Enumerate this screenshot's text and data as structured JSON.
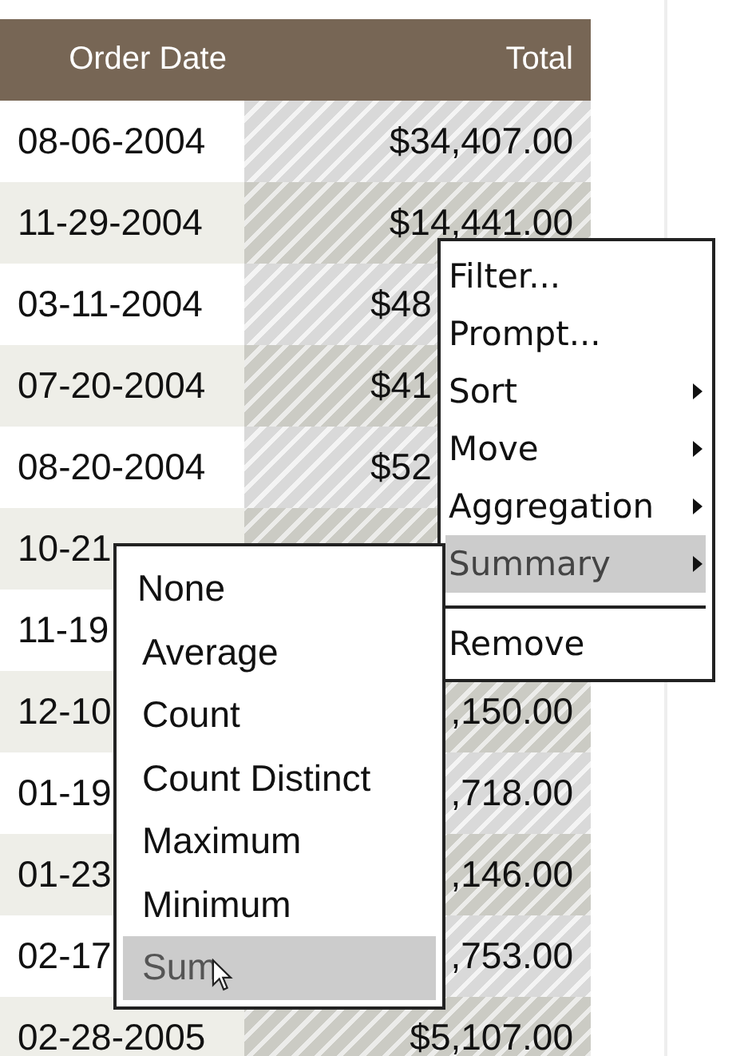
{
  "table": {
    "columns": [
      {
        "label": "Order Date"
      },
      {
        "label": "Total"
      }
    ],
    "rows": [
      {
        "date": "08-06-2004",
        "total": "$34,407.00",
        "total_cut_at_end": false
      },
      {
        "date": "11-29-2004",
        "total": "$14,441.00",
        "total_cut_at_end": false
      },
      {
        "date": "03-11-2004",
        "total": "$48",
        "total_cut_at_end": true
      },
      {
        "date": "07-20-2004",
        "total": "$41",
        "total_cut_at_end": true
      },
      {
        "date": "08-20-2004",
        "total": "$52",
        "total_cut_at_end": true
      },
      {
        "date": "10-21"
      },
      {
        "date": "11-19"
      },
      {
        "date": "12-10",
        "total": ",150.00",
        "total_cut_at_end": false
      },
      {
        "date": "01-19",
        "total": ",718.00",
        "total_cut_at_end": false
      },
      {
        "date": "01-23",
        "total": ",146.00",
        "total_cut_at_end": false
      },
      {
        "date": "02-17",
        "total": ",753.00",
        "total_cut_at_end": false
      },
      {
        "date": "02-28-2005",
        "total": "$5,107.00",
        "total_cut_at_end": false
      }
    ]
  },
  "context_menu": {
    "items": [
      {
        "label": "Filter...",
        "submenu": false,
        "selected": false,
        "separator_before": false
      },
      {
        "label": "Prompt...",
        "submenu": false,
        "selected": false,
        "separator_before": false
      },
      {
        "label": "Sort",
        "submenu": true,
        "selected": false,
        "separator_before": false
      },
      {
        "label": "Move",
        "submenu": true,
        "selected": false,
        "separator_before": false
      },
      {
        "label": "Aggregation",
        "submenu": true,
        "selected": false,
        "separator_before": false
      },
      {
        "label": "Summary",
        "submenu": true,
        "selected": true,
        "separator_before": false
      },
      {
        "label": "Remove",
        "submenu": false,
        "selected": false,
        "separator_before": true
      }
    ]
  },
  "submenu": {
    "items": [
      {
        "label": "None",
        "selected": false
      },
      {
        "label": "Average",
        "selected": false
      },
      {
        "label": "Count",
        "selected": false
      },
      {
        "label": "Count Distinct",
        "selected": false
      },
      {
        "label": "Maximum",
        "selected": false
      },
      {
        "label": "Minimum",
        "selected": false
      },
      {
        "label": "Sum",
        "selected": true
      }
    ]
  }
}
